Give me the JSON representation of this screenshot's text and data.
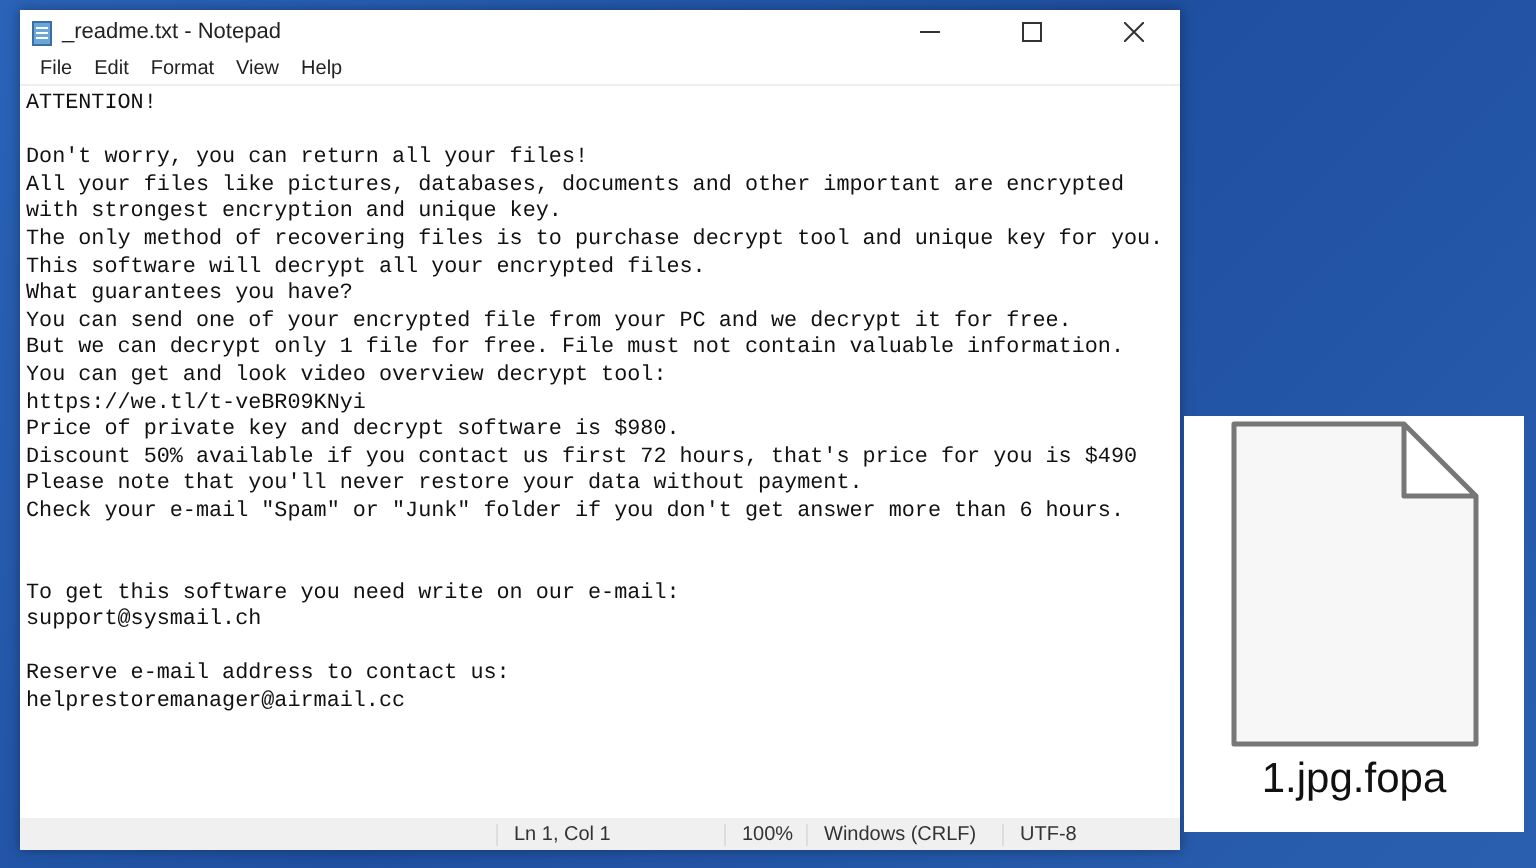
{
  "window": {
    "title": "_readme.txt - Notepad"
  },
  "menu": [
    "File",
    "Edit",
    "Format",
    "View",
    "Help"
  ],
  "document": [
    {
      "kind": "paragraph",
      "lines": [
        "ATTENTION!"
      ]
    },
    {
      "kind": "paragraph",
      "lines": [
        "Don't worry, you can return all your files!",
        "All your files like pictures, databases, documents and other important are encrypted",
        "with strongest encryption and unique key.",
        "The only method of recovering files is to purchase decrypt tool and unique key for you.",
        "This software will decrypt all your encrypted files.",
        "What guarantees you have?",
        "You can send one of your encrypted file from your PC and we decrypt it for free.",
        "But we can decrypt only 1 file for free. File must not contain valuable information.",
        "You can get and look video overview decrypt tool:",
        "https://we.tl/t-veBR09KNyi",
        "Price of private key and decrypt software is $980.",
        "Discount 50% available if you contact us first 72 hours, that's price for you is $490",
        "Please note that you'll never restore your data without payment.",
        "Check your e-mail \"Spam\" or \"Junk\" folder if you don't get answer more than 6 hours."
      ]
    },
    {
      "kind": "section",
      "lines": [
        "To get this software you need write on our e-mail:",
        "support@sysmail.ch"
      ]
    },
    {
      "kind": "paragraph",
      "lines": [
        "Reserve e-mail address to contact us:",
        "helprestoremanager@airmail.cc"
      ]
    }
  ],
  "status_bar": [
    "Ln 1, Col 1",
    "100%",
    "Windows (CRLF)",
    "UTF-8"
  ],
  "file_icon": {
    "name": "1.jpg.fopa"
  }
}
